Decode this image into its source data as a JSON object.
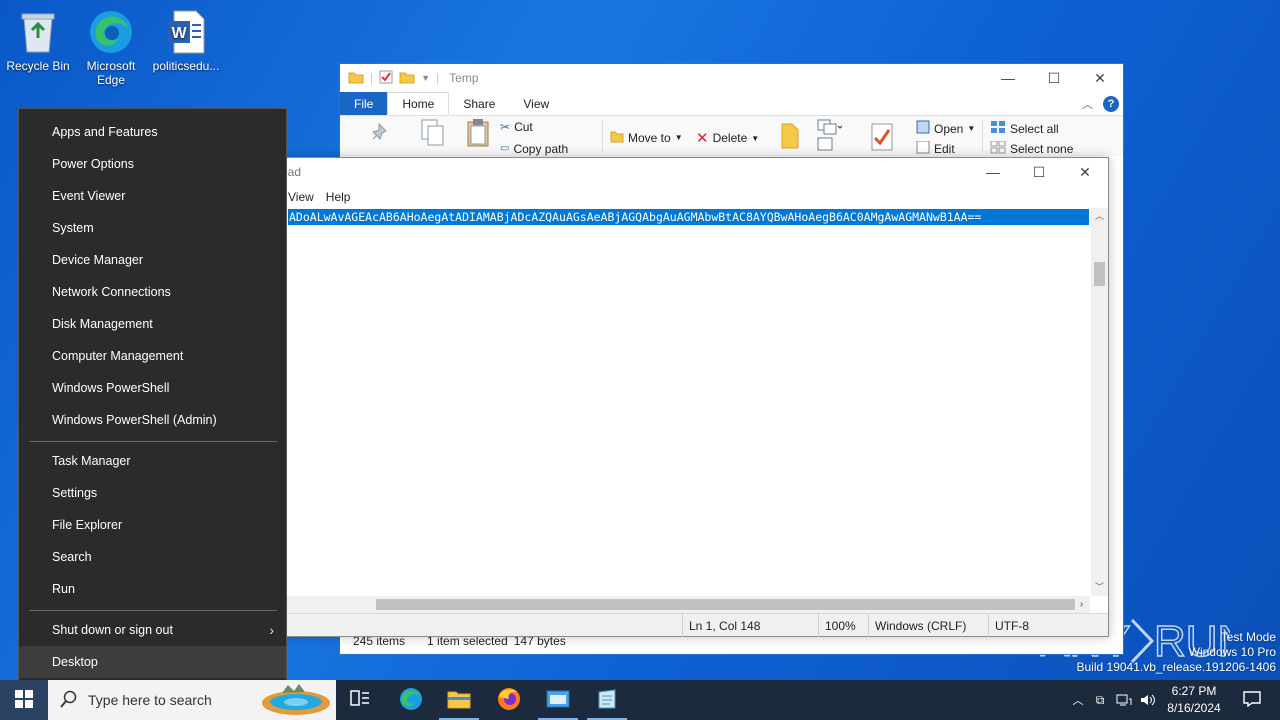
{
  "desktop": {
    "icons": [
      {
        "label": "Recycle Bin",
        "icon": "recycle-bin-icon"
      },
      {
        "label": "Microsoft Edge",
        "icon": "edge-icon"
      },
      {
        "label": "politicsedu...",
        "icon": "word-doc-icon"
      }
    ]
  },
  "explorer": {
    "title": "Temp",
    "tabs": [
      "File",
      "Home",
      "Share",
      "View"
    ],
    "ribbon": {
      "cut": "Cut",
      "copy_path": "Copy path",
      "move_to": "Move to",
      "delete": "Delete",
      "open": "Open",
      "edit": "Edit",
      "select_all": "Select all",
      "select_none": "Select none"
    },
    "status": {
      "items": "245 items",
      "selected": "1 item selected",
      "size": "147 bytes"
    }
  },
  "notepad": {
    "title": "pad",
    "menu": [
      "View",
      "Help"
    ],
    "content": "ADoALwAvAGEAcAB6AHoAegAtADIAMABjADcAZQAuAGsAeABjAGQAbgAuAGMAbwBtAC8AYQBwAHoAegB6AC0AMgAwAGMANwB1AA==",
    "status": {
      "position": "Ln 1, Col 148",
      "zoom": "100%",
      "line_ending": "Windows (CRLF)",
      "encoding": "UTF-8"
    }
  },
  "winx_menu": {
    "group1": [
      "Apps and Features",
      "Power Options",
      "Event Viewer",
      "System",
      "Device Manager",
      "Network Connections",
      "Disk Management",
      "Computer Management",
      "Windows PowerShell",
      "Windows PowerShell (Admin)"
    ],
    "group2": [
      "Task Manager",
      "Settings",
      "File Explorer",
      "Search",
      "Run"
    ],
    "group3": [
      "Shut down or sign out",
      "Desktop"
    ]
  },
  "taskbar": {
    "search_placeholder": "Type here to search",
    "time": "6:27 PM",
    "date": "8/16/2024"
  },
  "watermark": {
    "line1": "Test Mode",
    "line2": "Windows 10 Pro",
    "line3": "Build 19041.vb_release.191206-1406",
    "brand": "ANY.RUN"
  }
}
